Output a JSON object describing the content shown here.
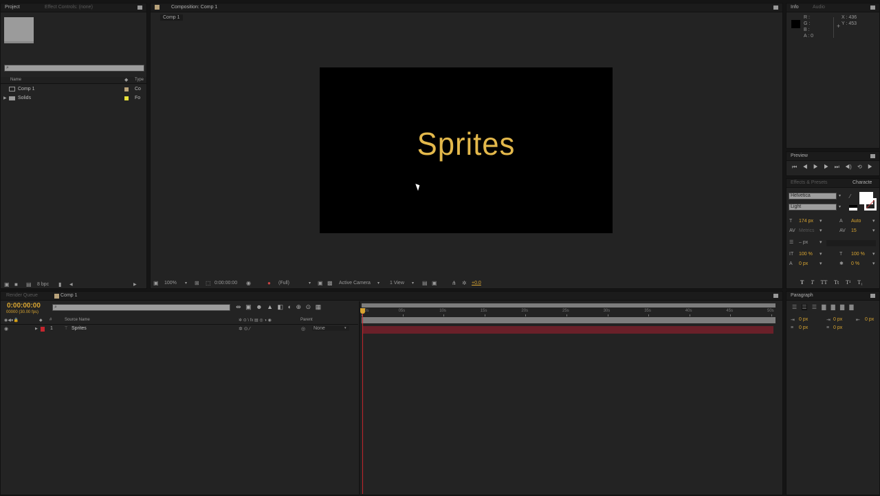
{
  "project": {
    "tab": "Project",
    "tab_inactive": "Effect Controls: (none)",
    "col_name": "Name",
    "col_type": "Type",
    "items": [
      {
        "name": "Comp 1",
        "type": "Co",
        "label_color": "#b8a27a"
      },
      {
        "name": "Solids",
        "type": "Fo",
        "label_color": "#e6e03a"
      }
    ],
    "bpc": "8 bpc"
  },
  "composition": {
    "tab": "Composition: Comp 1",
    "breadcrumb": "Comp 1",
    "canvas_text": "Sprites",
    "text_color": "#e3b84b",
    "toolbar": {
      "zoom": "100%",
      "timecode": "0:00:00:00",
      "resolution": "(Full)",
      "camera": "Active Camera",
      "views": "1 View",
      "exposure": "+0.0"
    }
  },
  "info": {
    "tab": "Info",
    "tab_inactive": "Audio",
    "r": "R :",
    "g": "G :",
    "b": "B :",
    "a": "A : 0",
    "x": "X : 436",
    "y": "Y : 453"
  },
  "preview": {
    "tab": "Preview"
  },
  "character": {
    "tab_inactive": "Effects & Presets",
    "tab": "Characte",
    "font": "Helvetica",
    "style": "Light",
    "size": "174 px",
    "leading": "Auto",
    "kerning": "Metrics",
    "tracking": "15",
    "stroke": "– px",
    "vscale": "100 %",
    "hscale": "100 %",
    "baseline": "0 px",
    "tsume": "0 %",
    "styles": [
      "T",
      "T",
      "TT",
      "Tt",
      "T¹",
      "T₁"
    ]
  },
  "paragraph": {
    "tab": "Paragraph",
    "indent_left": "0 px",
    "indent_first": "0 px",
    "indent_right": "0 px",
    "space_before": "0 px",
    "space_after": "0 px"
  },
  "timeline": {
    "tab_inactive": "Render Queue",
    "tab": "Comp 1",
    "timecode": "0:00:00:00",
    "frames": "00000 (30.00 fps)",
    "col_source": "Source Name",
    "col_parent": "Parent",
    "col_num": "#",
    "layers": [
      {
        "num": "1",
        "name": "Sprites",
        "parent": "None",
        "label_color": "#c4262e"
      }
    ],
    "ruler": [
      "0s",
      "05s",
      "10s",
      "15s",
      "20s",
      "25s",
      "30s",
      "35s",
      "40s",
      "45s",
      "50s"
    ]
  }
}
